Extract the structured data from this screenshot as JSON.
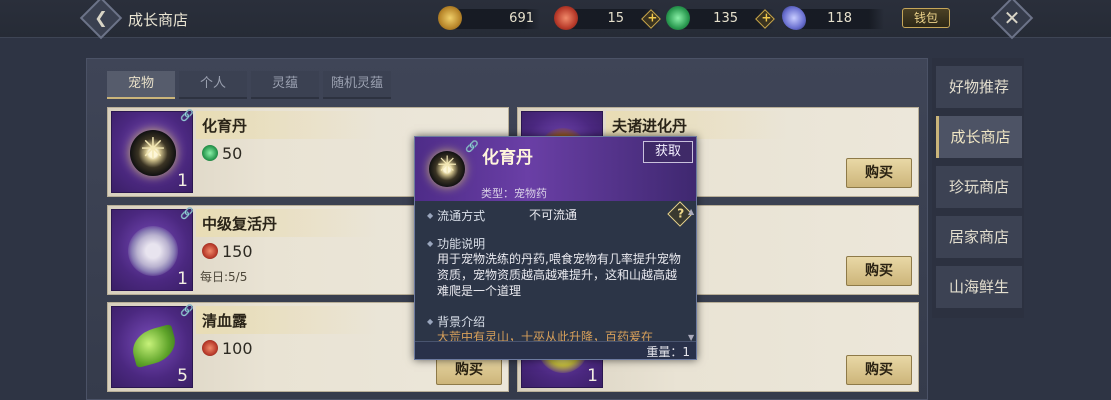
{
  "header": {
    "title": "成长商店",
    "wallet_label": "钱包",
    "close_icon": "✕",
    "back_icon": "❮"
  },
  "currencies": [
    {
      "name": "gold-coin",
      "value": "691",
      "color": "#c99a3a"
    },
    {
      "name": "red-coin",
      "value": "15",
      "color": "#c0443a"
    },
    {
      "name": "jade-coin",
      "value": "135",
      "color": "#3aa060"
    },
    {
      "name": "crystal",
      "value": "118",
      "color": "#7a80d8"
    }
  ],
  "tabs": [
    {
      "label": "宠物",
      "active": true
    },
    {
      "label": "个人"
    },
    {
      "label": "灵蕴"
    },
    {
      "label": "随机灵蕴"
    }
  ],
  "items": [
    {
      "name": "化育丹",
      "price": "50",
      "currency": "jade",
      "qty": "1",
      "limit": "",
      "buy": "购买"
    },
    {
      "name": "夫诸进化丹",
      "price": "",
      "currency": "",
      "qty": "",
      "limit": "",
      "buy": "购买"
    },
    {
      "name": "中级复活丹",
      "price": "150",
      "currency": "red",
      "qty": "1",
      "limit": "每日:5/5",
      "buy": "购买"
    },
    {
      "name": "",
      "price": "",
      "currency": "",
      "qty": "",
      "limit": "",
      "buy": "购买"
    },
    {
      "name": "清血露",
      "price": "100",
      "currency": "red",
      "qty": "5",
      "limit": "",
      "buy": "购买"
    },
    {
      "name": "",
      "price": "",
      "currency": "",
      "qty": "1",
      "limit": "",
      "buy": "购买"
    }
  ],
  "sidebar": [
    {
      "label": "好物推荐"
    },
    {
      "label": "成长商店",
      "active": true
    },
    {
      "label": "珍玩商店"
    },
    {
      "label": "居家商店"
    },
    {
      "label": "山海鲜生"
    }
  ],
  "popup": {
    "title": "化育丹",
    "type": "类型：宠物药",
    "get_label": "获取",
    "circulation_label": "流通方式",
    "circulation_value": "不可流通",
    "function_label": "功能说明",
    "function_text": "用于宠物洗练的丹药,喂食宠物有几率提升宠物资质，宠物资质越高越难提升，这和山越高越难爬是一个道理",
    "background_label": "背景介绍",
    "background_text": "大荒中有灵山，十巫从此升降，百药爰在",
    "weight": "重量：1"
  }
}
